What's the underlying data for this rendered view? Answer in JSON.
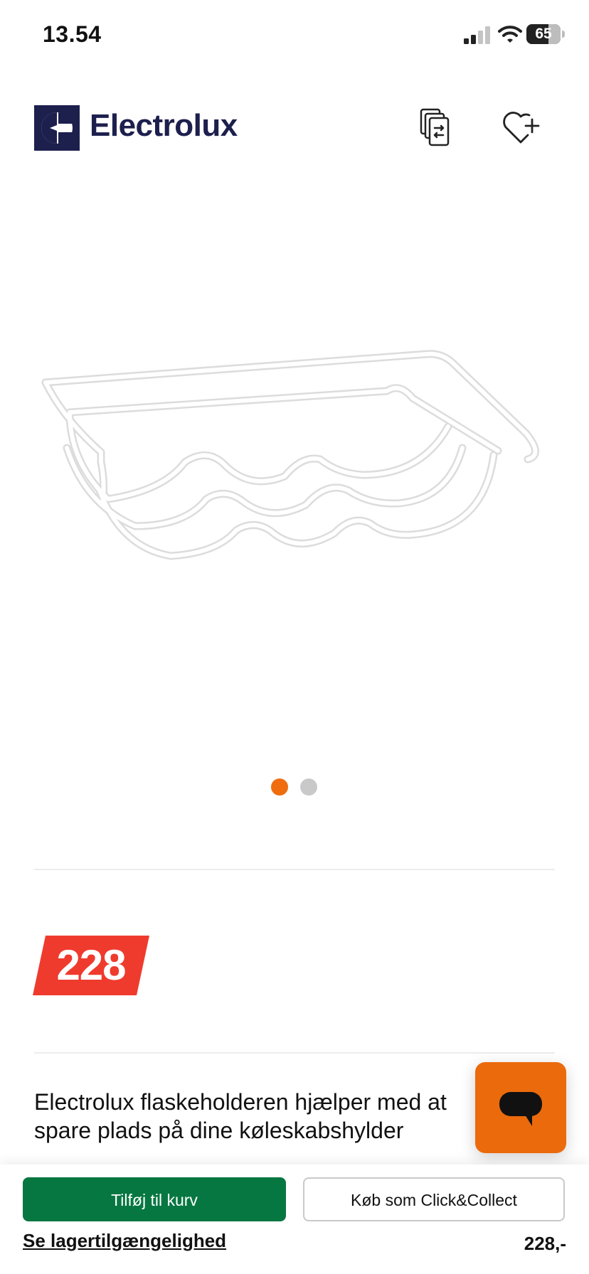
{
  "status_bar": {
    "time": "13.54",
    "battery_level": "65",
    "battery_fraction": 0.65
  },
  "header": {
    "brand": "Electrolux",
    "logo_icon": "electrolux-logo-icon",
    "compare_icon": "compare-icon",
    "wishlist_icon": "heart-plus-icon",
    "brand_color": "#1d1f4d"
  },
  "gallery": {
    "image": "wire-bottle-rack",
    "slides_total": 2,
    "active_slide": 1,
    "active_dot_color": "#ef6c0f",
    "inactive_dot_color": "#c9c9c9"
  },
  "price": {
    "badge_value": "228",
    "badge_color": "#ef3b2d"
  },
  "description": "Electrolux flaskeholderen hjælper med at spare plads på dine køleskabshylder",
  "chat": {
    "icon": "chat-bubble-icon",
    "color": "#eb6a0c"
  },
  "bottom_bar": {
    "add_to_cart_label": "Tilføj til kurv",
    "add_to_cart_color": "#067741",
    "click_collect_label": "Køb som Click&Collect",
    "stock_link_label": "Se lagertilgængelighed",
    "price_text": "228,-"
  }
}
